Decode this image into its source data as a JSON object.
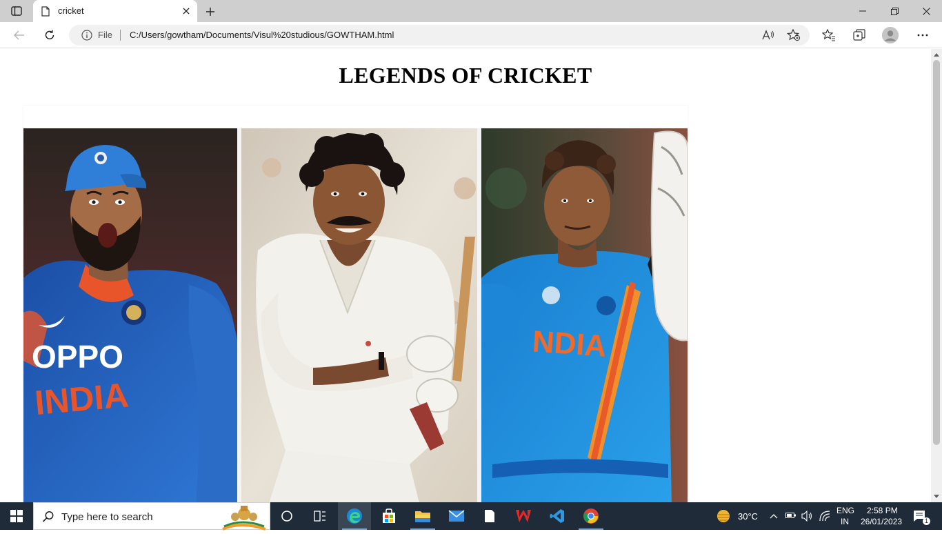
{
  "browser": {
    "tab_title": "cricket",
    "address": {
      "scheme_label": "File",
      "url": "C:/Users/gowtham/Documents/Visul%20studious/GOWTHAM.html"
    }
  },
  "page": {
    "heading": "LEGENDS OF CRICKET",
    "image": {
      "description_icon": "cricket-legends-collage",
      "panels": [
        {
          "jersey_text_top": "OPPO",
          "jersey_text_bottom": "INDIA"
        },
        {
          "jersey_text_top": "",
          "jersey_text_bottom": ""
        },
        {
          "jersey_text_top": "",
          "jersey_text_bottom": "NDIA"
        }
      ]
    }
  },
  "taskbar": {
    "search_placeholder": "Type here to search",
    "weather": "30°C",
    "lang_top": "ENG",
    "lang_bottom": "IN",
    "time": "2:58 PM",
    "date": "26/01/2023",
    "notification_count": "1"
  },
  "colors": {
    "tabstrip": "#cfcfcf",
    "taskbar": "#1f2b39",
    "india_blue": "#1f6fc4",
    "jersey_orange": "#e8552b"
  }
}
